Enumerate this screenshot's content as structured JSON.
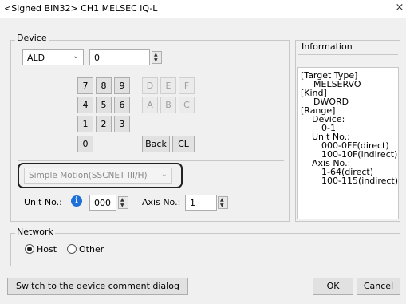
{
  "window": {
    "title": "<Signed BIN32> CH1 MELSEC iQ-L",
    "close_glyph": "×"
  },
  "device": {
    "legend": "Device",
    "type_value": "ALD",
    "number_value": "0",
    "keypad": {
      "digits": [
        "7",
        "8",
        "9",
        "4",
        "5",
        "6",
        "1",
        "2",
        "3",
        "0"
      ],
      "hex": [
        "D",
        "E",
        "F",
        "A",
        "B",
        "C"
      ],
      "back_label": "Back",
      "clear_label": "CL"
    },
    "module_value": "Simple Motion(SSCNET III/H)",
    "unit_label": "Unit No.:",
    "unit_value": "000",
    "axis_label": "Axis No.:",
    "axis_value": "1"
  },
  "information": {
    "legend": "Information",
    "lines": [
      "[Target Type]",
      "MELSERVO",
      "[Kind]",
      "DWORD",
      "[Range]",
      "Device:",
      "0-1",
      "Unit No.:",
      "000-0FF(direct)",
      "100-10F(indirect)",
      "Axis No.:",
      "1-64(direct)",
      "100-115(indirect)"
    ]
  },
  "network": {
    "legend": "Network",
    "host_label": "Host",
    "other_label": "Other",
    "selected": "Host"
  },
  "footer": {
    "switch_label": "Switch to the device comment dialog",
    "ok_label": "OK",
    "cancel_label": "Cancel"
  },
  "colors": {
    "info_icon": "#1e6fd9",
    "highlight_border": "#222222"
  }
}
